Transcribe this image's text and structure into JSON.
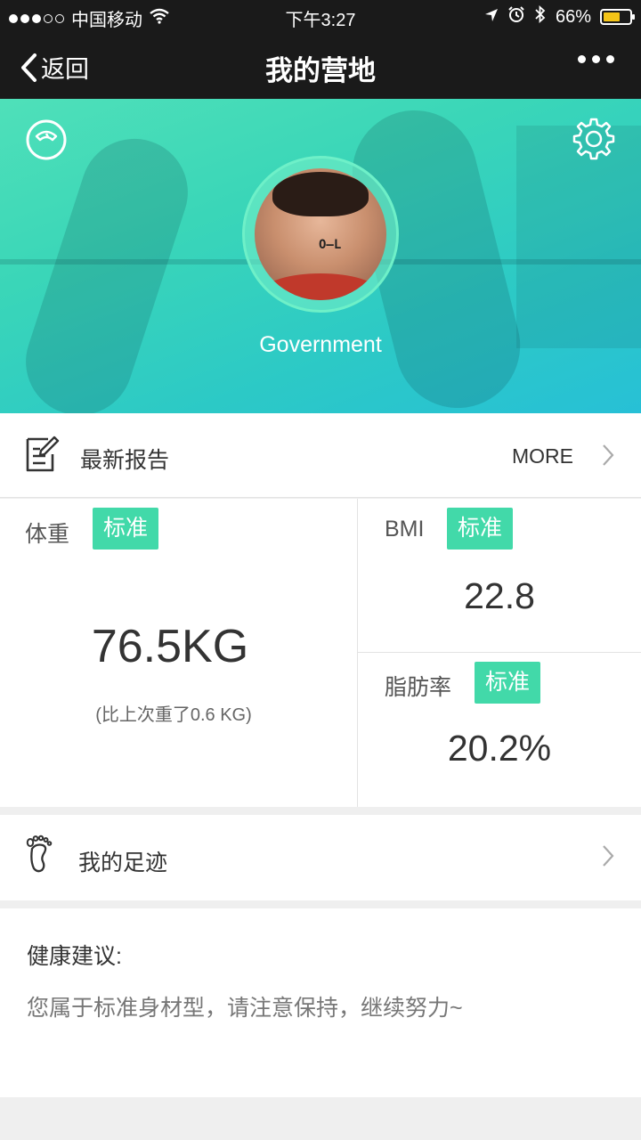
{
  "status_bar": {
    "carrier": "中国移动",
    "time": "下午3:27",
    "battery_percent": "66%",
    "battery_level": 0.66,
    "signal_bars": 3,
    "icons": [
      "wifi-icon",
      "location-icon",
      "alarm-icon",
      "bluetooth-icon",
      "battery-icon"
    ]
  },
  "nav": {
    "back_label": "返回",
    "title": "我的营地",
    "more_icon": "more-dots-icon"
  },
  "hero": {
    "username": "Government",
    "avatar_text": "O—L",
    "left_icon": "scale-icon",
    "right_icon": "gear-icon"
  },
  "report": {
    "title": "最新报告",
    "more_label": "MORE"
  },
  "metrics": {
    "weight": {
      "label": "体重",
      "badge": "标准",
      "value": "76.5KG",
      "diff": "(比上次重了0.6 KG)"
    },
    "bmi": {
      "label": "BMI",
      "badge": "标准",
      "value": "22.8"
    },
    "body_fat": {
      "label": "脂肪率",
      "badge": "标准",
      "value": "20.2%"
    }
  },
  "footprint": {
    "label": "我的足迹"
  },
  "advice": {
    "title": "健康建议:",
    "text": "您属于标准身材型，请注意保持，继续努力~"
  },
  "colors": {
    "nav_background": "#1a1a1a",
    "hero_gradient_start": "#4fe0b9",
    "hero_gradient_end": "#27c0d6",
    "badge": "#42d9a9",
    "battery_fill": "#f5c518"
  }
}
